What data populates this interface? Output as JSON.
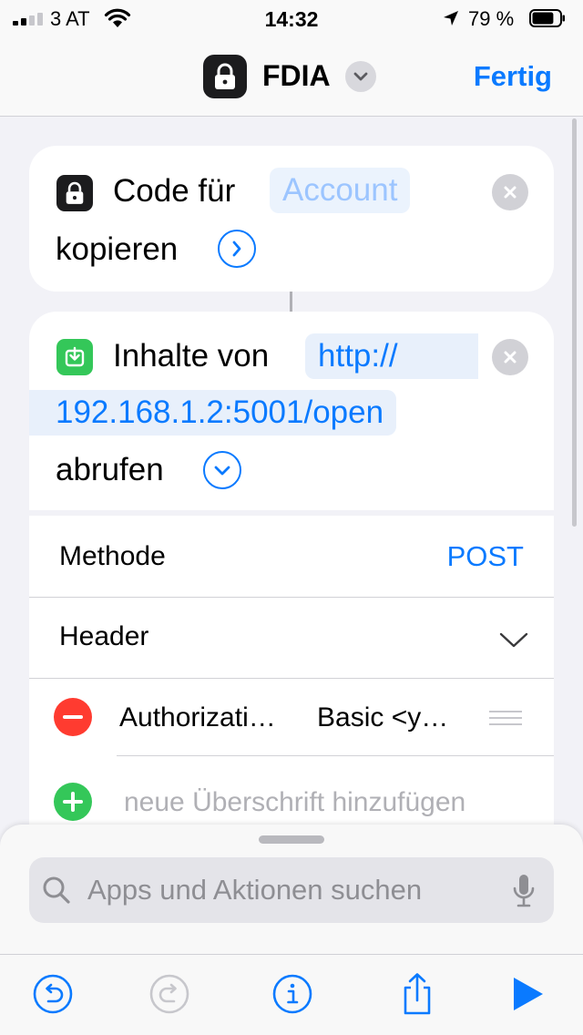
{
  "status_bar": {
    "carrier": "3 AT",
    "time": "14:32",
    "battery_percent": "79 %",
    "battery_level": 0.79
  },
  "nav": {
    "title": "FDIA",
    "done_label": "Fertig"
  },
  "action1": {
    "text_before": "Code für",
    "token_placeholder": "Account",
    "text_after": "kopieren"
  },
  "action2": {
    "text_before": "Inhalte von",
    "url_part1": "http://",
    "url_part2": "192.168.1.2:5001/open",
    "text_after": "abrufen",
    "method_label": "Methode",
    "method_value": "POST",
    "header_label": "Header",
    "header_key": "Authorizati…",
    "header_value": "Basic <y…",
    "add_header_placeholder": "neue Überschrift hinzufügen"
  },
  "search": {
    "placeholder": "Apps und Aktionen suchen"
  },
  "colors": {
    "accent": "#0a7aff",
    "destructive": "#ff3b30",
    "add": "#34c759",
    "get_contents_icon": "#34c759"
  },
  "icons": {
    "nav_app": "lock-icon",
    "action1": "lock-icon",
    "action2": "download-icon",
    "toolbar": [
      "undo-icon",
      "redo-icon",
      "info-icon",
      "share-icon",
      "play-icon"
    ]
  }
}
